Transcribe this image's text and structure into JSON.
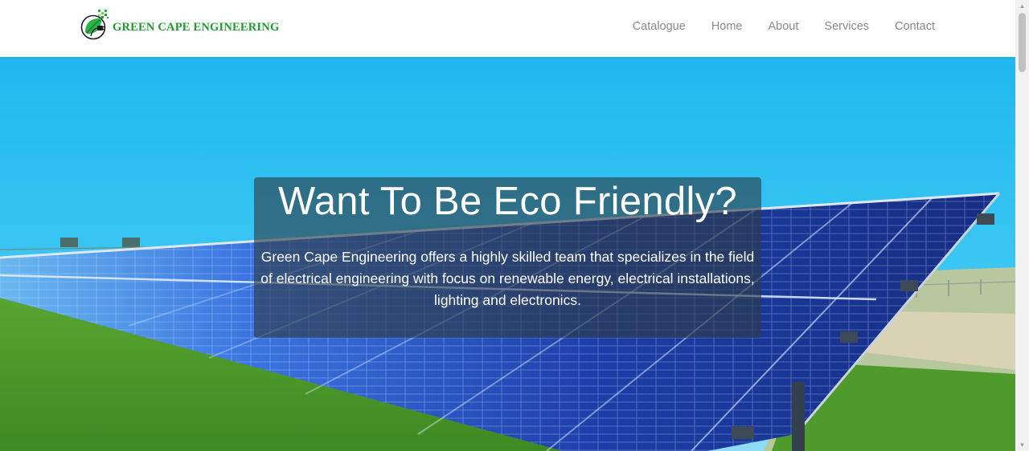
{
  "brand": {
    "name": "GREEN CAPE ENGINEERING",
    "logo_icon": "leaf-plug-icon",
    "color": "#1e9a2e"
  },
  "nav": {
    "items": [
      {
        "label": "Catalogue"
      },
      {
        "label": "Home"
      },
      {
        "label": "About"
      },
      {
        "label": "Services"
      },
      {
        "label": "Contact"
      }
    ]
  },
  "hero": {
    "title": "Want To Be Eco Friendly?",
    "text": "Green Cape Engineering offers a highly skilled team that specializes in the field of electrical engineering with focus on renewable energy, electrical installations, lighting and electronics.",
    "image": "solar-panel-field-photo"
  },
  "scrollbar": {
    "up_icon": "triangle-up-icon",
    "down_icon": "triangle-down-icon"
  }
}
